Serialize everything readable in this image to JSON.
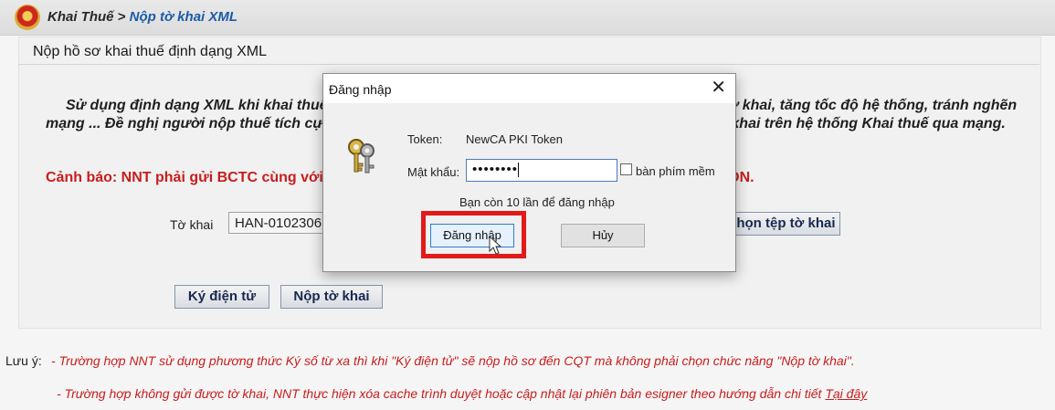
{
  "header": {
    "breadcrumb_root": "Khai Thuế",
    "breadcrumb_sep": " > ",
    "breadcrumb_current": "Nộp tờ khai XML"
  },
  "main": {
    "section_title": "Nộp hồ sơ khai thuế định dạng XML",
    "description": "Sử dụng định dạng XML khi khai thuế qua mạng sẽ giúp người nộp thuế giảm dung lượng gửi tờ khai, tăng tốc độ hệ thống, tránh nghẽn mạng ... Đề nghị người nộp thuế tích cực sử dụng ứng dụng hỗ trợ kê khai xuất file XML để gửi tờ khai trên hệ thống Khai thuế qua mạng.",
    "warning": "Cảnh báo: NNT phải gửi BCTC cùng với tờ khai quyết toán TNDN hoặc gửi kèm theo tờ khai 03/TNDN.",
    "form_label": "Tờ khai",
    "file_value": "HAN-0102306",
    "choose_file_label": "Chọn tệp tờ khai",
    "sign_label": "Ký điện tử",
    "submit_label": "Nộp tờ khai"
  },
  "notes": {
    "prefix": "Lưu ý:",
    "note1": "- Trường hợp NNT sử dụng phương thức Ký số từ xa thì khi \"Ký điện tử\" sẽ nộp hồ sơ đến CQT mà không phải chọn chức năng \"Nộp tờ khai\".",
    "note2": "- Trường hợp không gửi được tờ khai, NNT thực hiện xóa cache trình duyệt hoặc cập nhật lại phiên bản esigner theo hướng dẫn chi tiết ",
    "note2_link": "Tại đây"
  },
  "dialog": {
    "title": "Đăng nhập",
    "close_glyph": "✕",
    "token_label": "Token:",
    "token_value": "NewCA PKI Token",
    "password_label": "Mật khẩu:",
    "password_mask": "••••••••",
    "virtual_keyboard_label": "bàn phím mềm",
    "virtual_keyboard_checked": false,
    "attempts_text": "Bạn còn 10 lần để đăng nhập",
    "login_button": "Đăng nhập",
    "cancel_button": "Hủy",
    "highlight_color": "#e21a1a"
  },
  "icons": {
    "emblem": "national-emblem-icon",
    "dialog_icon": "keys-icon",
    "cursor": "mouse-pointer-icon"
  }
}
